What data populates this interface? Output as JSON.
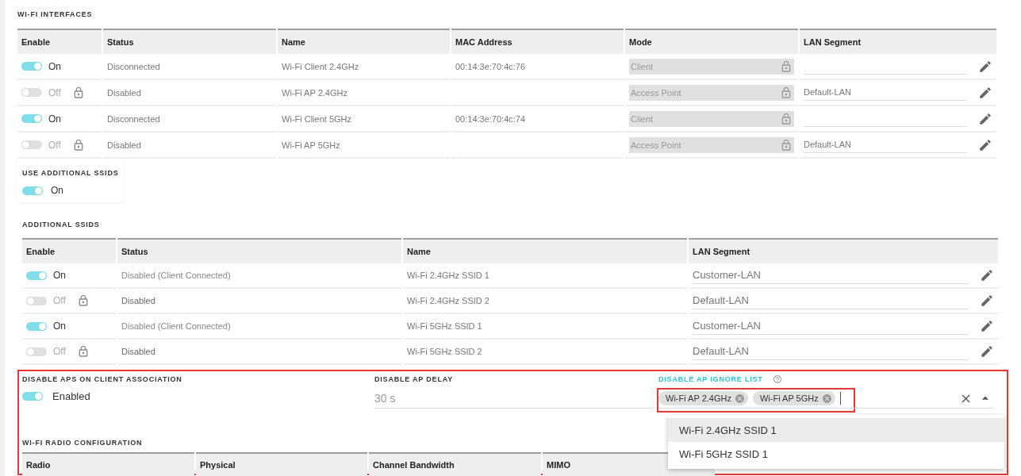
{
  "wifi_interfaces": {
    "title": "WI-FI INTERFACES",
    "columns": [
      "Enable",
      "Status",
      "Name",
      "MAC Address",
      "Mode",
      "LAN Segment"
    ],
    "rows": [
      {
        "enabled": true,
        "toggle_label": "On",
        "locked": false,
        "status": "Disconnected",
        "name": "Wi-Fi Client 2.4GHz",
        "mac": "00:14:3e:70:4c:76",
        "mode": "Client"
      },
      {
        "enabled": false,
        "toggle_label": "Off",
        "locked": true,
        "status": "Disabled",
        "name": "Wi-Fi AP 2.4GHz",
        "mode": "Access Point",
        "lan_segment": "Default-LAN"
      },
      {
        "enabled": true,
        "toggle_label": "On",
        "locked": false,
        "status": "Disconnected",
        "name": "Wi-Fi Client 5GHz",
        "mac": "00:14:3e:70:4c:74",
        "mode": "Client"
      },
      {
        "enabled": false,
        "toggle_label": "Off",
        "locked": true,
        "status": "Disabled",
        "name": "Wi-Fi AP 5GHz",
        "mode": "Access Point",
        "lan_segment": "Default-LAN"
      }
    ]
  },
  "use_additional_ssids": {
    "label": "USE ADDITIONAL SSIDS",
    "on": true,
    "toggle_label": "On"
  },
  "additional_ssids": {
    "title": "ADDITIONAL SSIDS",
    "columns": [
      "Enable",
      "Status",
      "Name",
      "LAN Segment"
    ],
    "rows": [
      {
        "enabled": true,
        "toggle_label": "On",
        "locked": false,
        "status": "Disabled (Client Connected)",
        "name": "Wi-Fi 2.4GHz SSID 1",
        "lan_segment": "Customer-LAN"
      },
      {
        "enabled": false,
        "toggle_label": "Off",
        "locked": true,
        "status": "Disabled",
        "name": "Wi-Fi 2.4GHz SSID 2",
        "lan_segment": "Default-LAN"
      },
      {
        "enabled": true,
        "toggle_label": "On",
        "locked": false,
        "status": "Disabled (Client Connected)",
        "name": "Wi-Fi 5GHz SSID 1",
        "lan_segment": "Customer-LAN"
      },
      {
        "enabled": false,
        "toggle_label": "Off",
        "locked": true,
        "status": "Disabled",
        "name": "Wi-Fi 5GHz SSID 2",
        "lan_segment": "Default-LAN"
      }
    ]
  },
  "disable_aps_on_client_association": {
    "label": "DISABLE APS ON CLIENT ASSOCIATION",
    "on": true,
    "toggle_label": "Enabled"
  },
  "disable_ap_delay": {
    "label": "DISABLE AP DELAY",
    "value": "30 s"
  },
  "disable_ap_ignore_list": {
    "label": "DISABLE AP IGNORE LIST",
    "chips": [
      "Wi-Fi AP 2.4GHz",
      "Wi-Fi AP 5GHz"
    ],
    "options": [
      {
        "label": "Wi-Fi 2.4GHz SSID 1",
        "selected": true
      },
      {
        "label": "Wi-Fi 5GHz SSID 1",
        "selected": false
      }
    ]
  },
  "wifi_radio_configuration": {
    "title": "WI-FI RADIO CONFIGURATION",
    "columns": [
      "Radio",
      "Physical",
      "Channel Bandwidth",
      "MIMO"
    ]
  }
}
